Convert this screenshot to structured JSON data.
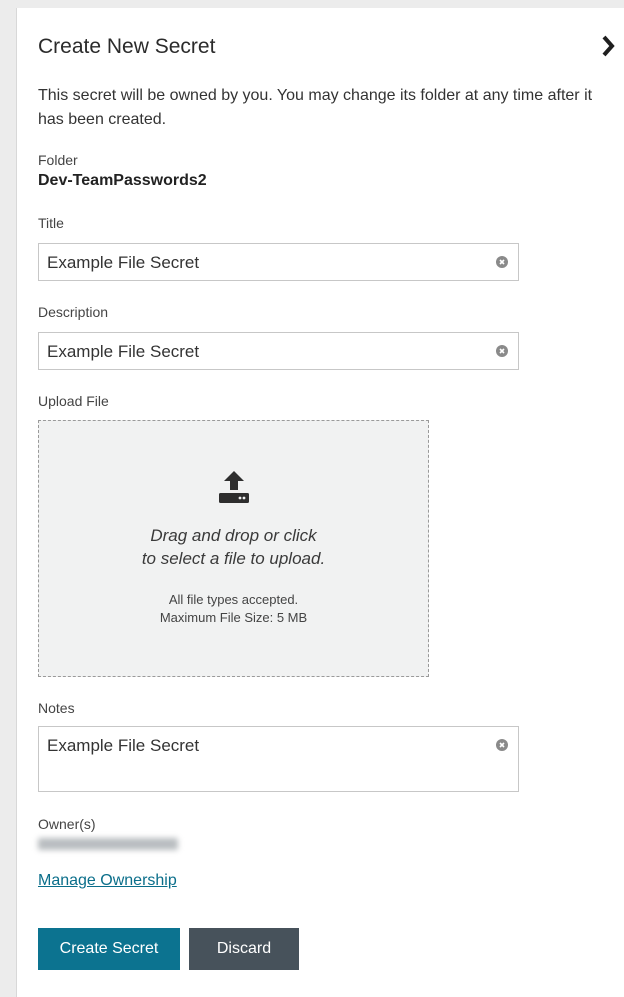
{
  "header": {
    "title": "Create New Secret",
    "collapse_icon": "chevron-right-icon"
  },
  "intro": "This secret will be owned by you. You may change its folder at any time after it has been created.",
  "folder": {
    "label": "Folder",
    "value": "Dev-TeamPasswords2"
  },
  "title_field": {
    "label": "Title",
    "value": "Example File Secret",
    "clear_icon": "clear-icon"
  },
  "description_field": {
    "label": "Description",
    "value": "Example File Secret",
    "clear_icon": "clear-icon"
  },
  "upload": {
    "label": "Upload File",
    "icon": "upload-icon",
    "prompt_line1": "Drag and drop or click",
    "prompt_line2": "to select a file to upload.",
    "accepted": "All file types accepted.",
    "max_size": "Maximum File Size: 5 MB"
  },
  "notes_field": {
    "label": "Notes",
    "value": "Example File Secret",
    "clear_icon": "clear-icon"
  },
  "owners": {
    "label": "Owner(s)"
  },
  "manage_ownership": "Manage Ownership",
  "buttons": {
    "create": "Create Secret",
    "discard": "Discard"
  },
  "colors": {
    "primary": "#0c7390",
    "secondary": "#47525b",
    "link": "#0a6e8a"
  }
}
